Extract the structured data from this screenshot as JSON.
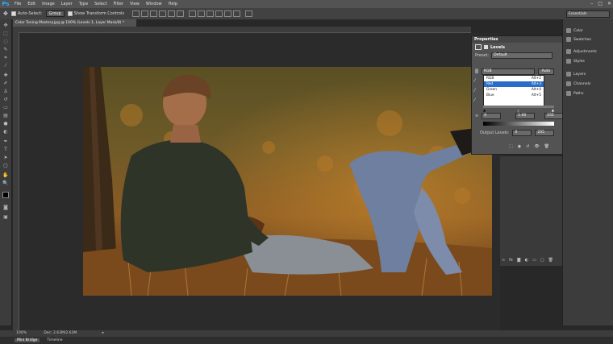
{
  "app": {
    "logo": "Ps"
  },
  "menu": [
    "File",
    "Edit",
    "Image",
    "Layer",
    "Type",
    "Select",
    "Filter",
    "View",
    "Window",
    "Help"
  ],
  "window_controls": {
    "minimize": "–",
    "maximize": "□",
    "close": "✕"
  },
  "options_bar": {
    "auto_select_label": "Auto-Select:",
    "auto_select_value": "Group",
    "show_transform_label": "Show Transform Controls",
    "workspace": "Essentials"
  },
  "document": {
    "tab_title": "Color Toning Mastery.jpg @ 100% (Levels 1, Layer Mask/8) *",
    "zoom": "100%",
    "doc_info": "Doc: 2.63M/2.63M"
  },
  "properties": {
    "panel_title": "Properties",
    "adjustment_name": "Levels",
    "preset_label": "Preset:",
    "preset_value": "Default",
    "channel_value": "RGB",
    "auto_button": "Auto",
    "channel_options": [
      {
        "name": "RGB",
        "shortcut": "Alt+2"
      },
      {
        "name": "Red",
        "shortcut": "Alt+3"
      },
      {
        "name": "Green",
        "shortcut": "Alt+4"
      },
      {
        "name": "Blue",
        "shortcut": "Alt+5"
      }
    ],
    "input_black": "0",
    "input_gamma": "1.00",
    "input_white": "255",
    "output_label": "Output Levels:",
    "output_black": "0",
    "output_white": "255"
  },
  "dock": [
    {
      "label": "Color",
      "icon": "color-icon"
    },
    {
      "label": "Swatches",
      "icon": "swatches-icon"
    },
    {
      "label": "Adjustments",
      "icon": "adjustments-icon"
    },
    {
      "label": "Styles",
      "icon": "styles-icon"
    },
    {
      "label": "Layers",
      "icon": "layers-icon"
    },
    {
      "label": "Channels",
      "icon": "channels-icon"
    },
    {
      "label": "Paths",
      "icon": "paths-icon"
    }
  ],
  "bottom_tabs": [
    "Mini Bridge",
    "Timeline"
  ]
}
